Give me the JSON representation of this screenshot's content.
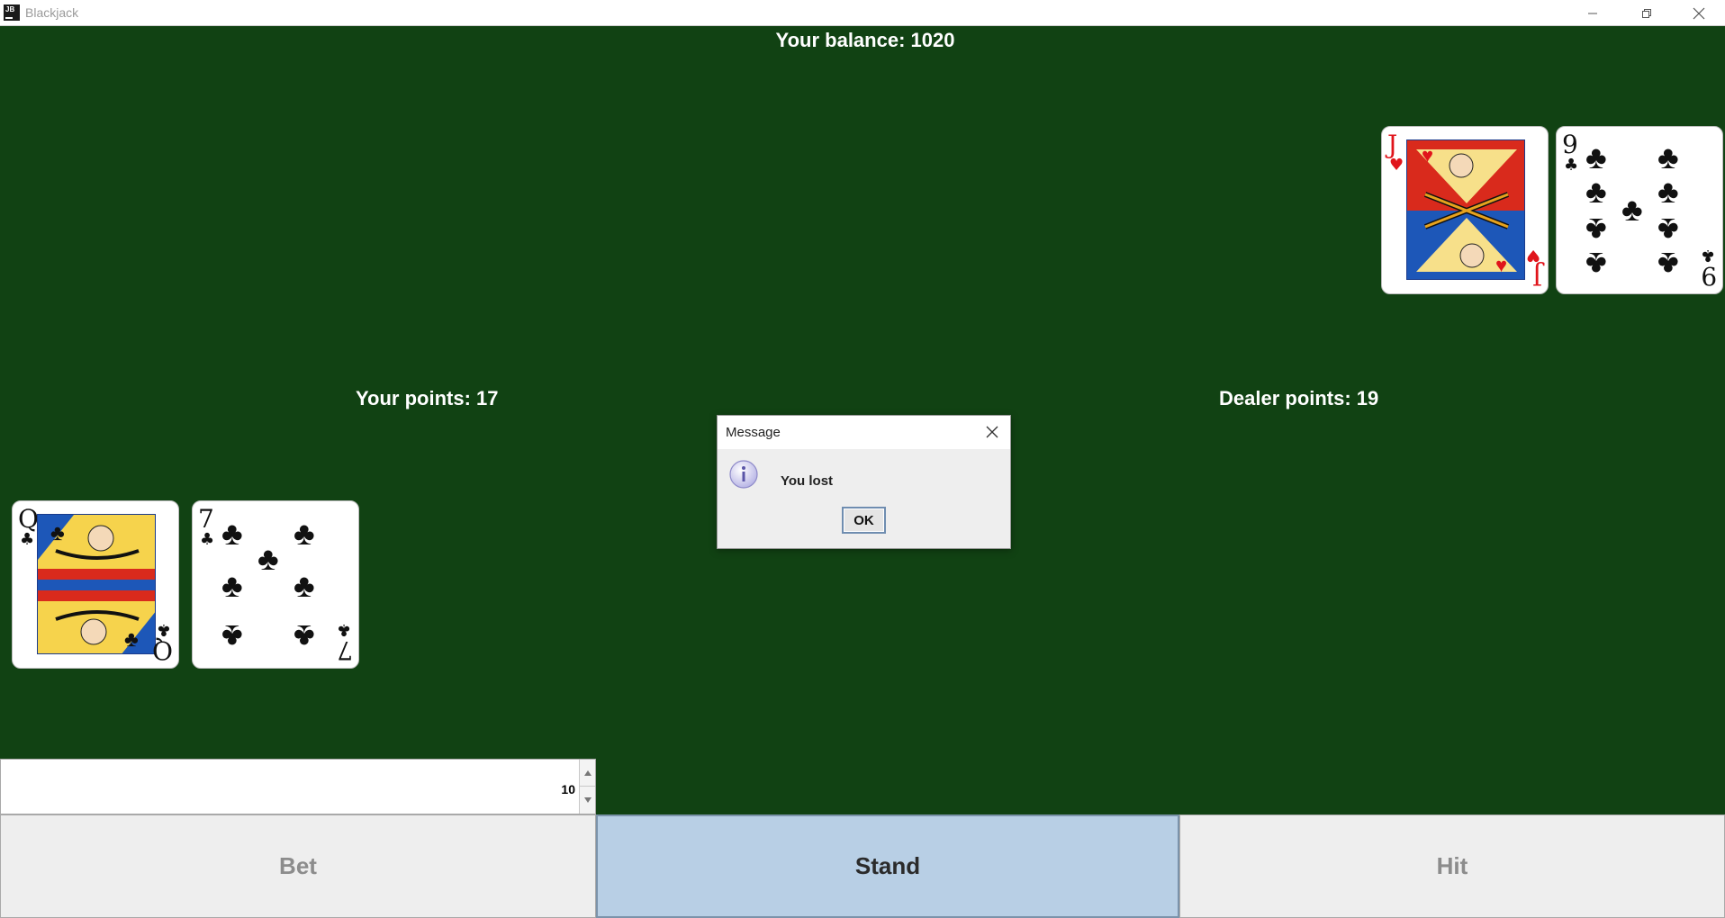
{
  "window": {
    "title": "Blackjack",
    "icon": "jetbrains-app-icon",
    "icon_text": "JB"
  },
  "table": {
    "balance_label": "Your balance: 1020",
    "player_points_label": "Your points: 17",
    "dealer_points_label": "Dealer points: 19"
  },
  "dealer_cards": [
    {
      "rank": "J",
      "suit": "♥",
      "color": "#e0141b",
      "suit_name": "hearts"
    },
    {
      "rank": "9",
      "suit": "♣",
      "color": "#111111",
      "suit_name": "clubs"
    }
  ],
  "player_cards": [
    {
      "rank": "Q",
      "suit": "♣",
      "color": "#111111",
      "suit_name": "clubs"
    },
    {
      "rank": "7",
      "suit": "♣",
      "color": "#111111",
      "suit_name": "clubs"
    }
  ],
  "bet_spinner": {
    "value": "10"
  },
  "buttons": {
    "bet_label": "Bet",
    "stand_label": "Stand",
    "hit_label": "Hit"
  },
  "dialog": {
    "title": "Message",
    "message": "You lost",
    "ok_label": "OK",
    "icon": "info-icon"
  },
  "colors": {
    "table_green": "#114213",
    "stand_highlight": "#b8cfe5",
    "disabled_text": "#8c8c8c"
  }
}
